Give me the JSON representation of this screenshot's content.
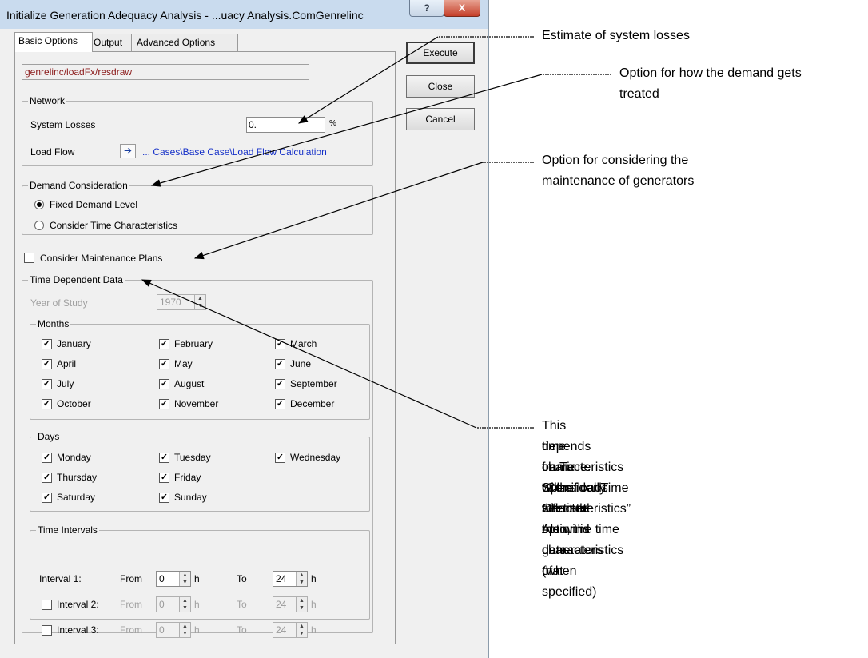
{
  "window": {
    "title": "Initialize Generation Adequacy Analysis - ...uacy Analysis.ComGenrelinc",
    "help_label": "?",
    "close_label": "X"
  },
  "tabs": [
    {
      "label": "Basic Options",
      "active": true
    },
    {
      "label": "Output",
      "active": false
    },
    {
      "label": "Advanced Options",
      "active": false
    }
  ],
  "buttons": {
    "execute": "Execute",
    "close": "Close",
    "cancel": "Cancel"
  },
  "path": "genrelinc/loadFx/resdraw",
  "network": {
    "legend": "Network",
    "system_losses_label": "System Losses",
    "system_losses_value": "0.",
    "unit": "%",
    "load_flow_label": "Load Flow",
    "load_flow_link": "... Cases\\Base Case\\Load Flow Calculation",
    "jump_icon": "arrow-right-icon"
  },
  "demand": {
    "legend": "Demand Consideration",
    "options": [
      {
        "label": "Fixed Demand Level",
        "selected": true
      },
      {
        "label": "Consider Time Characteristics",
        "selected": false
      }
    ]
  },
  "maintenance": {
    "label": "Consider Maintenance Plans",
    "checked": false
  },
  "time_data": {
    "legend": "Time Dependent Data",
    "year_label": "Year of Study",
    "year_value": "1970",
    "months_legend": "Months",
    "months": [
      {
        "label": "January",
        "checked": true
      },
      {
        "label": "February",
        "checked": true
      },
      {
        "label": "March",
        "checked": true
      },
      {
        "label": "April",
        "checked": true
      },
      {
        "label": "May",
        "checked": true
      },
      {
        "label": "June",
        "checked": true
      },
      {
        "label": "July",
        "checked": true
      },
      {
        "label": "August",
        "checked": true
      },
      {
        "label": "September",
        "checked": true
      },
      {
        "label": "October",
        "checked": true
      },
      {
        "label": "November",
        "checked": true
      },
      {
        "label": "December",
        "checked": true
      }
    ],
    "days_legend": "Days",
    "days": [
      {
        "label": "Monday",
        "checked": true
      },
      {
        "label": "Tuesday",
        "checked": true
      },
      {
        "label": "Wednesday",
        "checked": true
      },
      {
        "label": "Thursday",
        "checked": true
      },
      {
        "label": "Friday",
        "checked": true
      },
      {
        "label": "Saturday",
        "checked": true
      },
      {
        "label": "Sunday",
        "checked": true
      }
    ],
    "intervals_legend": "Time Intervals",
    "intervals": [
      {
        "label": "Interval 1:",
        "from_label": "From",
        "from_value": "0",
        "to_label": "To",
        "to_value": "24",
        "unit": "h",
        "enabled": true
      },
      {
        "label": "Interval 2:",
        "from_label": "From",
        "from_value": "0",
        "to_label": "To",
        "to_value": "24",
        "unit": "h",
        "enabled": false
      },
      {
        "label": "Interval 3:",
        "from_label": "From",
        "from_value": "0",
        "to_label": "To",
        "to_value": "24",
        "unit": "h",
        "enabled": false
      }
    ]
  },
  "annotations": {
    "losses": "Estimate of system losses",
    "demand_line1": "Option for how the demand gets",
    "demand_line2": "treated",
    "maint_line1": "Option for considering the",
    "maint_line2": "maintenance of generators",
    "time_lines": [
      "This time frame will affect the data that",
      "depends on Time. Specifically, the time",
      "characteristics of the loads when the",
      "“Consider Time Characteristics” option is",
      "selected. Also, the time characteristics of",
      "the wind generators (when specified)"
    ]
  }
}
